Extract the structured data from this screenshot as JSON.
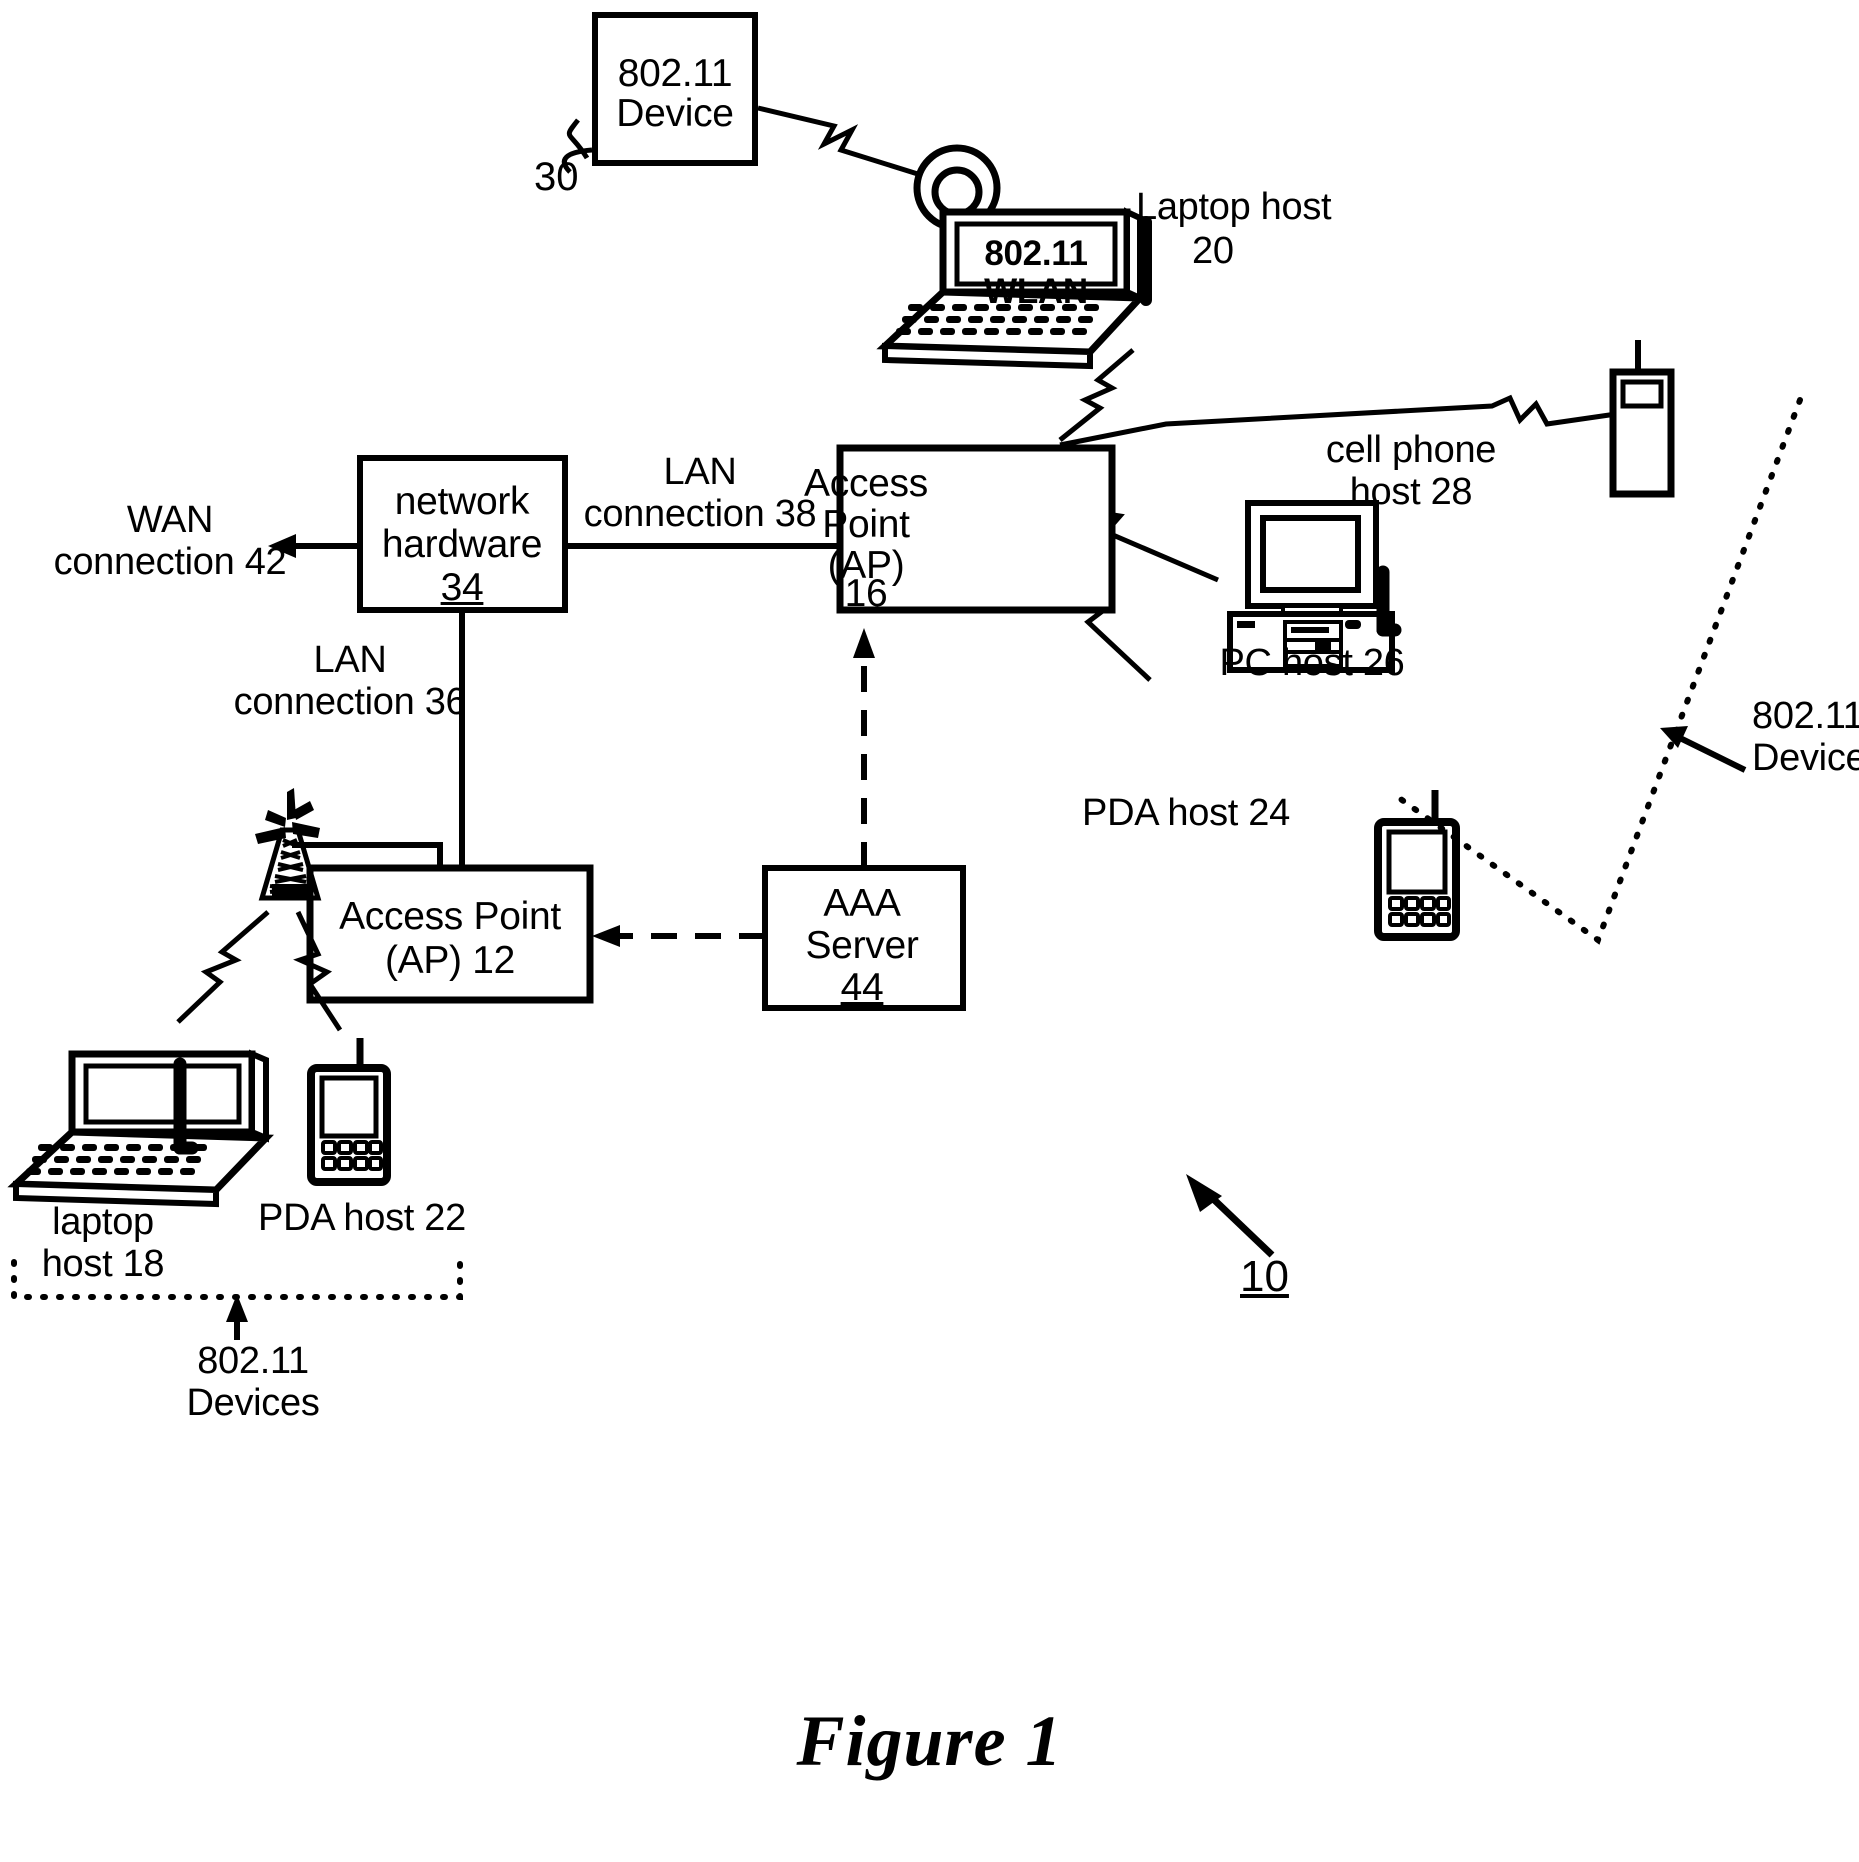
{
  "figure": {
    "caption": "Figure 1",
    "system_ref": "10"
  },
  "boxes": {
    "device_802_11": {
      "line1": "802.11",
      "line2": "Device",
      "ref": "30"
    },
    "network_hardware": {
      "line1": "network",
      "line2": "hardware",
      "ref": "34"
    },
    "access_point_16": {
      "line1": "Access",
      "line2": "Point",
      "line3": "(AP)",
      "ref": "16"
    },
    "access_point_12": {
      "line1": "Access Point",
      "line2_prefix": "(AP) ",
      "ref": "12"
    },
    "aaa_server": {
      "line1": "AAA",
      "line2": "Server",
      "ref": "44"
    }
  },
  "devices": {
    "laptop_wlan": {
      "screen_line1": "802.11",
      "screen_line2": "WLAN",
      "label_line1": "Laptop host",
      "label_line2": "20"
    },
    "cell_phone": {
      "label_line1": "cell phone",
      "label_line2": "host 28"
    },
    "pc_host": {
      "label": "PC host 26"
    },
    "pda_host_24": {
      "label": "PDA host 24"
    },
    "pda_host_22": {
      "label": "PDA host 22"
    },
    "laptop_host_18": {
      "label_line1": "laptop",
      "label_line2": "host 18"
    }
  },
  "connections": {
    "wan": {
      "line1": "WAN",
      "line2": "connection 42"
    },
    "lan_38": {
      "line1": "LAN",
      "line2": "connection 38"
    },
    "lan_36": {
      "line1": "LAN",
      "line2": "connection 36"
    }
  },
  "groups": {
    "devices_right": {
      "line1": "802.11",
      "line2": "Devices"
    },
    "devices_bottom": {
      "line1": "802.11",
      "line2": "Devices"
    }
  },
  "style": {
    "stroke": "#000000",
    "background": "#ffffff"
  }
}
